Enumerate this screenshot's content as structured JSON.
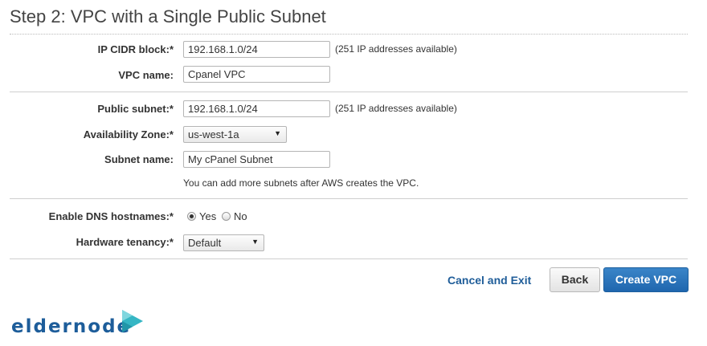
{
  "page": {
    "title": "Step 2: VPC with a Single Public Subnet"
  },
  "vpc": {
    "cidr_label": "IP CIDR block:*",
    "cidr_value": "192.168.1.0/24",
    "cidr_note": "(251 IP addresses available)",
    "name_label": "VPC name:",
    "name_value": "Cpanel VPC"
  },
  "subnet": {
    "public_label": "Public subnet:*",
    "public_value": "192.168.1.0/24",
    "public_note": "(251 IP addresses available)",
    "az_label": "Availability Zone:*",
    "az_value": "us-west-1a",
    "name_label": "Subnet name:",
    "name_value": "My cPanel Subnet",
    "help_text": "You can add more subnets after AWS creates the VPC."
  },
  "options": {
    "dns_label": "Enable DNS hostnames:*",
    "dns_yes": "Yes",
    "dns_no": "No",
    "dns_selected": "Yes",
    "tenancy_label": "Hardware tenancy:*",
    "tenancy_value": "Default"
  },
  "actions": {
    "cancel_label": "Cancel and Exit",
    "back_label": "Back",
    "create_label": "Create VPC"
  },
  "watermark": {
    "text": "eldernode"
  }
}
